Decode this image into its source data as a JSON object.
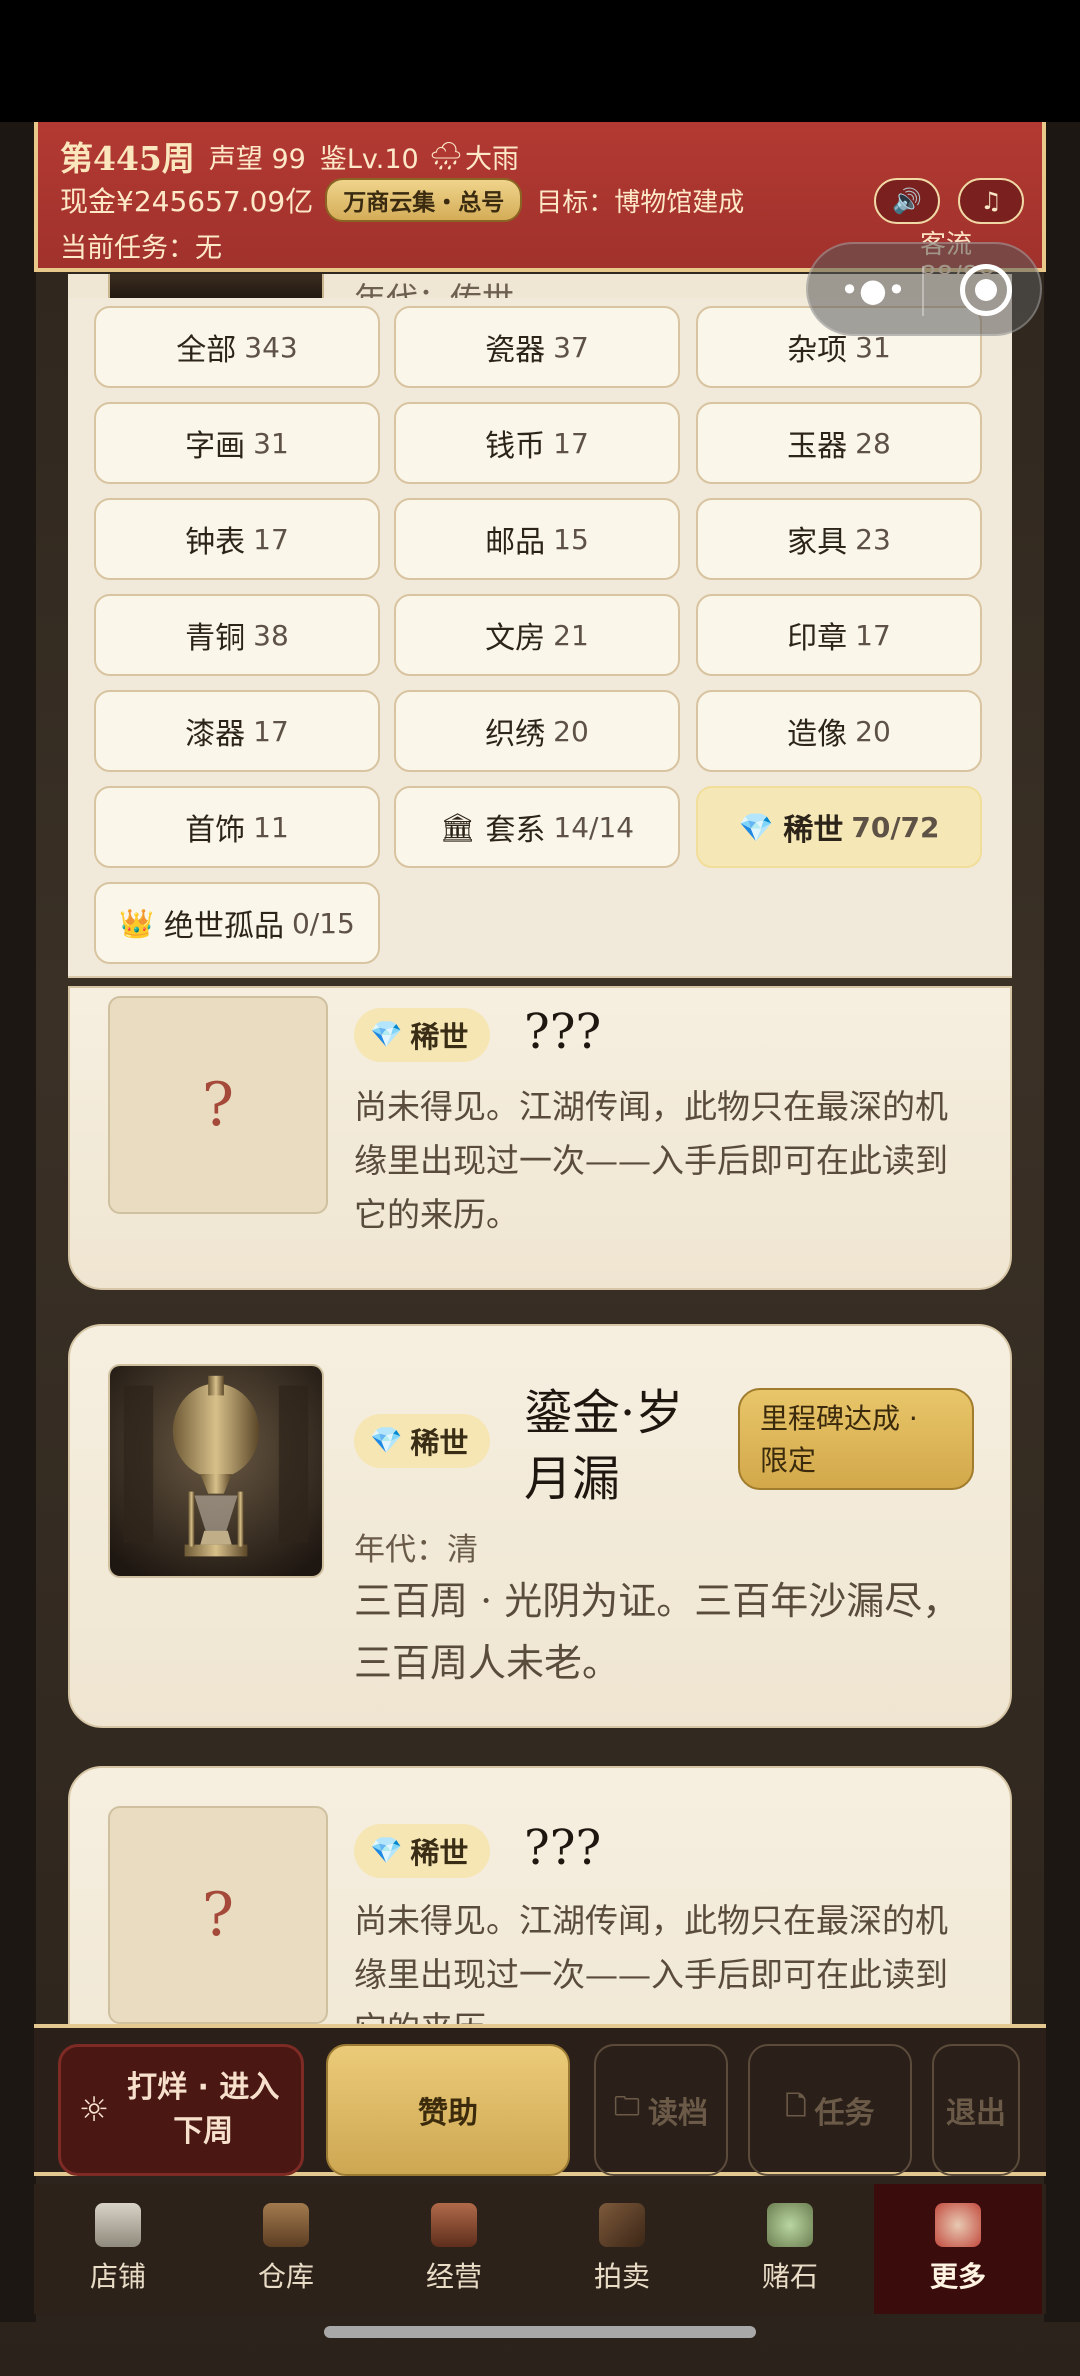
{
  "header": {
    "week": "第445周",
    "reputation": "声望 99",
    "appraisal": "鉴Lv.10",
    "weather_icon": "storm-cloud-icon",
    "weather": "大雨",
    "cash": "现金¥245657.09亿",
    "tag": "万商云集・总号",
    "goal": "目标：博物馆建成",
    "task": "当前任务：无",
    "sound_icon": "speaker-icon",
    "music_icon": "music-note-icon",
    "flow": "客流 88/88"
  },
  "peek": {
    "era": "年代：传世"
  },
  "filters": [
    {
      "label": "全部",
      "count": "343"
    },
    {
      "label": "瓷器",
      "count": "37"
    },
    {
      "label": "杂项",
      "count": "31"
    },
    {
      "label": "字画",
      "count": "31"
    },
    {
      "label": "钱币",
      "count": "17"
    },
    {
      "label": "玉器",
      "count": "28"
    },
    {
      "label": "钟表",
      "count": "17"
    },
    {
      "label": "邮品",
      "count": "15"
    },
    {
      "label": "家具",
      "count": "23"
    },
    {
      "label": "青铜",
      "count": "38"
    },
    {
      "label": "文房",
      "count": "21"
    },
    {
      "label": "印章",
      "count": "17"
    },
    {
      "label": "漆器",
      "count": "17"
    },
    {
      "label": "织绣",
      "count": "20"
    },
    {
      "label": "造像",
      "count": "20"
    },
    {
      "label": "首饰",
      "count": "11"
    },
    {
      "label": "套系",
      "count": "14/14",
      "icon": "🏛"
    },
    {
      "label": "稀世",
      "count": "70/72",
      "icon": "💎",
      "active": true
    },
    {
      "label": "绝世孤品",
      "count": "0/15",
      "icon": "👑"
    }
  ],
  "cards": [
    {
      "badge": "稀世",
      "name": "???",
      "placeholder": "?",
      "desc": "尚未得见。江湖传闻，此物只在最深的机缘里出现过一次——入手后即可在此读到它的来历。"
    },
    {
      "badge": "稀世",
      "name": "鎏金·岁月漏",
      "tag": "里程碑达成 · 限定",
      "era": "年代：清",
      "desc": "三百周 · 光阴为证。三百年沙漏尽，三百周人未老。"
    },
    {
      "badge": "稀世",
      "name": "???",
      "placeholder": "?",
      "desc": "尚未得见。江湖传闻，此物只在最深的机缘里出现过一次——入手后即可在此读到它的来历。"
    }
  ],
  "actions": {
    "next_week": "打烊 · 进入下周",
    "sponsor": "赞助",
    "load": "读档",
    "tasks": "任务",
    "exit": "退出"
  },
  "tabs": [
    {
      "label": "店铺",
      "icon": "storefront-icon"
    },
    {
      "label": "仓库",
      "icon": "treasure-chest-icon"
    },
    {
      "label": "经营",
      "icon": "abacus-icon"
    },
    {
      "label": "拍卖",
      "icon": "gavel-icon"
    },
    {
      "label": "赌石",
      "icon": "jade-stone-icon"
    },
    {
      "label": "更多",
      "icon": "lucky-bag-icon",
      "active": true
    }
  ],
  "colors": {
    "header_red": "#a1312c",
    "gold": "#d4ad58",
    "rare_badge": "#f6e6b4",
    "active_tab": "#3a0d0c"
  }
}
